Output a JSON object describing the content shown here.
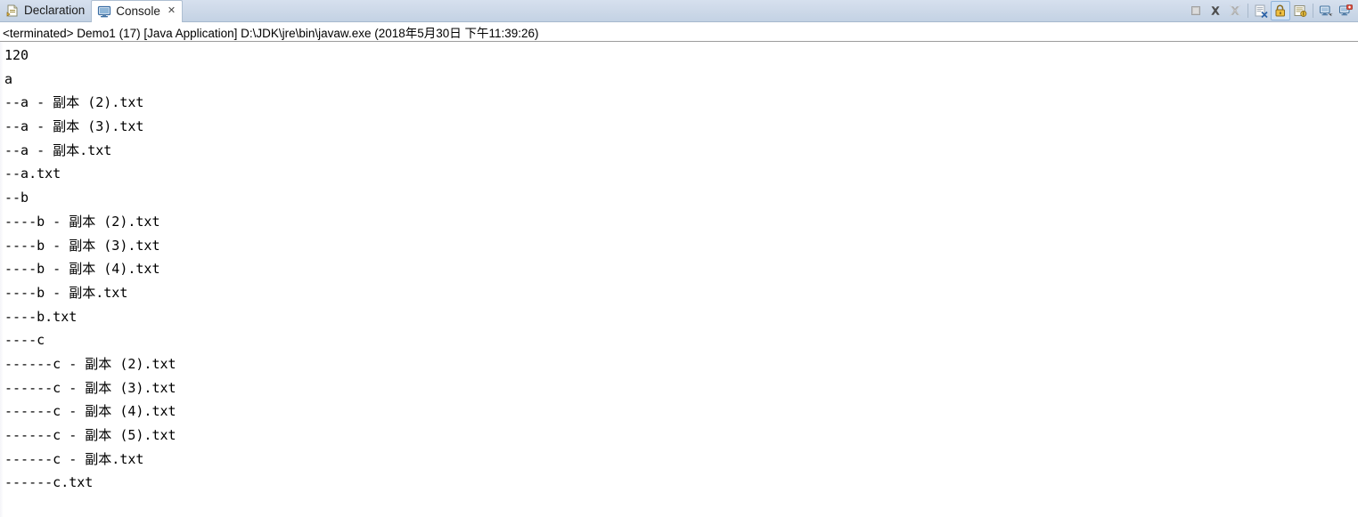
{
  "window": {
    "app": "Eclipse IDE",
    "view": "Console"
  },
  "tabs": [
    {
      "label": "Declaration",
      "icon": "declaration-view-icon",
      "active": false,
      "closable": false
    },
    {
      "label": "Console",
      "icon": "console-view-icon",
      "active": true,
      "closable": true,
      "close_glyph": "✕"
    }
  ],
  "toolbar": {
    "buttons": [
      {
        "name": "terminate-button",
        "title": "Terminate",
        "icon": "terminate-icon",
        "enabled": false,
        "toggled": false
      },
      {
        "name": "remove-launch-button",
        "title": "Remove Launch",
        "icon": "remove-launch-icon",
        "enabled": true,
        "toggled": false
      },
      {
        "name": "remove-all-terminated-button",
        "title": "Remove All Terminated Launches",
        "icon": "remove-all-terminated-icon",
        "enabled": false,
        "toggled": false
      },
      {
        "name": "clear-console-button",
        "title": "Clear Console",
        "icon": "clear-console-icon",
        "enabled": true,
        "toggled": false
      },
      {
        "name": "scroll-lock-button",
        "title": "Scroll Lock",
        "icon": "scroll-lock-icon",
        "enabled": true,
        "toggled": true
      },
      {
        "name": "pin-console-button",
        "title": "Pin Console",
        "icon": "pin-console-icon",
        "enabled": true,
        "toggled": false
      },
      {
        "name": "display-selected-console-button",
        "title": "Display Selected Console",
        "icon": "display-console-icon",
        "enabled": true,
        "toggled": false
      },
      {
        "name": "open-console-button",
        "title": "Open Console",
        "icon": "open-console-icon",
        "enabled": true,
        "toggled": false
      }
    ]
  },
  "launch": {
    "status": "<terminated>",
    "config_name": "Demo1 (17)",
    "type": "[Java Application]",
    "vm_path": "D:\\JDK\\jre\\bin\\javaw.exe",
    "timestamp": "(2018年5月30日 下午11:39:26)",
    "full_line": "<terminated> Demo1 (17) [Java Application] D:\\JDK\\jre\\bin\\javaw.exe (2018年5月30日 下午11:39:26)"
  },
  "console": {
    "lines": [
      "120",
      "a",
      "--a - 副本 (2).txt",
      "--a - 副本 (3).txt",
      "--a - 副本.txt",
      "--a.txt",
      "--b",
      "----b - 副本 (2).txt",
      "----b - 副本 (3).txt",
      "----b - 副本 (4).txt",
      "----b - 副本.txt",
      "----b.txt",
      "----c",
      "------c - 副本 (2).txt",
      "------c - 副本 (3).txt",
      "------c - 副本 (4).txt",
      "------c - 副本 (5).txt",
      "------c - 副本.txt",
      "------c.txt"
    ]
  },
  "colors": {
    "tabbar_bg": "#ccd8e8",
    "active_tab_bg": "#ffffff",
    "console_bg": "#ffffff",
    "text": "#000000",
    "toggled_btn_bg": "#cfe0f2",
    "separator": "#9c9c9c"
  }
}
